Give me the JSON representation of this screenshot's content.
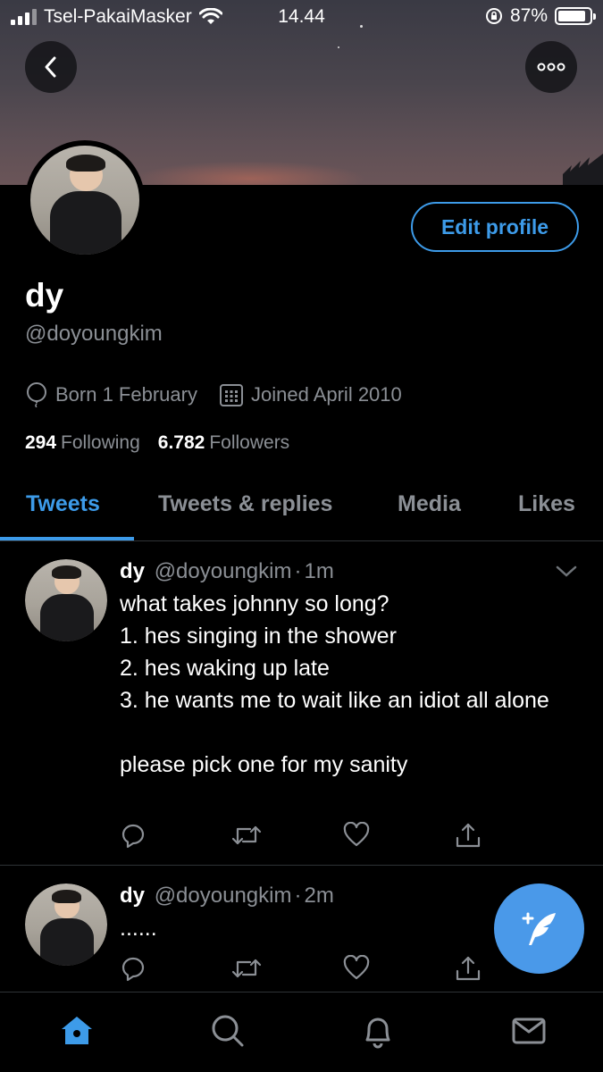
{
  "status_bar": {
    "carrier": "Tsel-PakaiMasker",
    "time": "14.44",
    "battery": "87%",
    "battery_level": 0.87
  },
  "header": {
    "back_icon": "chevron-left-icon",
    "more_icon": "more-dots-icon"
  },
  "profile": {
    "name": "dy",
    "handle": "@doyoungkim",
    "edit_label": "Edit profile",
    "birthday": "Born 1 February",
    "joined": "Joined April 2010",
    "following_count": "294",
    "following_label": "Following",
    "followers_count": "6.782",
    "followers_label": "Followers"
  },
  "tabs": [
    {
      "label": "Tweets",
      "active": true
    },
    {
      "label": "Tweets & replies",
      "active": false
    },
    {
      "label": "Media",
      "active": false
    },
    {
      "label": "Likes",
      "active": false
    }
  ],
  "tweets": [
    {
      "name": "dy",
      "handle": "@doyoungkim",
      "sep": "·",
      "time": "1m",
      "text": "what takes johnny so long?\n1. hes singing in the shower\n2. hes waking up late\n3. he wants me to wait like an idiot all alone\n\nplease pick one for my sanity"
    },
    {
      "name": "dy",
      "handle": "@doyoungkim",
      "sep": "·",
      "time": "2m",
      "text": "......"
    }
  ],
  "colors": {
    "accent": "#3d9be9",
    "muted": "#8b8f95",
    "background": "#000000",
    "divider": "#2f3336"
  },
  "bottom_nav": [
    "home-icon",
    "search-icon",
    "notifications-icon",
    "messages-icon"
  ]
}
